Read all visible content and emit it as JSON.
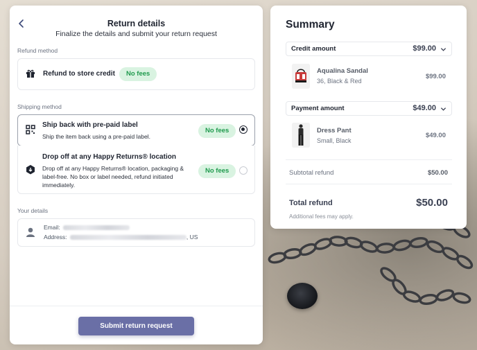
{
  "return_panel": {
    "title": "Return details",
    "subtitle": "Finalize the details and submit your return request",
    "refund_method": {
      "section_label": "Refund method",
      "option_label": "Refund to store credit",
      "fee_badge": "No fees"
    },
    "shipping_method": {
      "section_label": "Shipping method",
      "options": [
        {
          "title": "Ship back with pre-paid label",
          "description": "Ship the item back using a pre-paid label.",
          "fee_badge": "No fees",
          "selected": true
        },
        {
          "title": "Drop off at any Happy Returns® location",
          "description": "Drop off at any Happy Returns® location, packaging & label-free. No box or label needed, refund initiated immediately.",
          "fee_badge": "No fees",
          "selected": false
        }
      ]
    },
    "your_details": {
      "section_label": "Your details",
      "email_label": "Email:",
      "address_label": "Address:",
      "address_suffix": ", US"
    },
    "submit_label": "Submit return request"
  },
  "summary": {
    "title": "Summary",
    "credit": {
      "label": "Credit amount",
      "value": "$99.00",
      "item": {
        "name": "Aqualina Sandal",
        "meta": "36, Black & Red",
        "price": "$99.00"
      }
    },
    "payment": {
      "label": "Payment amount",
      "value": "$49.00",
      "item": {
        "name": "Dress Pant",
        "meta": "Small, Black",
        "price": "$49.00"
      }
    },
    "subtotal_label": "Subtotal refund",
    "subtotal_value": "$50.00",
    "total_label": "Total refund",
    "total_value": "$50.00",
    "note": "Additional fees may apply."
  },
  "colors": {
    "accent": "#6a6fa6",
    "fee_bg": "#d9f3e1",
    "fee_text": "#1f9a4d",
    "text": "#1f2430"
  },
  "icons": {
    "back": "chevron-left-icon",
    "refund": "gift-icon",
    "ship": "qr-code-icon",
    "dropoff": "box-drop-icon",
    "details": "user-icon",
    "dropdown": "chevron-down-icon"
  }
}
